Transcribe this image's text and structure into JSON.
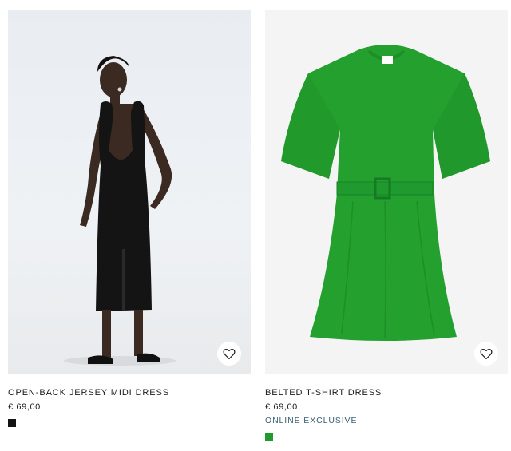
{
  "products": [
    {
      "name": "OPEN-BACK JERSEY MIDI DRESS",
      "price": "€ 69,00",
      "badge": "",
      "swatch_color": "#141414",
      "image_icon": "model-wearing-black-dress"
    },
    {
      "name": "BELTED T-SHIRT DRESS",
      "price": "€ 69,00",
      "badge": "ONLINE EXCLUSIVE",
      "swatch_color": "#1f9a2e",
      "image_icon": "green-belted-dress"
    }
  ],
  "colors": {
    "badge": "#3b5f76",
    "dress_green": "#23a02e"
  },
  "icons": {
    "favorite": "heart-icon"
  }
}
